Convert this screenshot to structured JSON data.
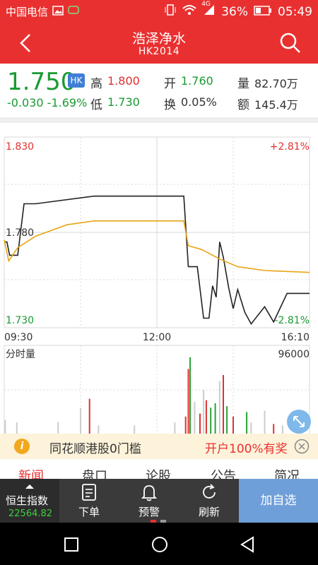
{
  "status_bar": {
    "carrier": "中国电信",
    "signal_label": "4G",
    "battery": "36%",
    "time": "05:49"
  },
  "header": {
    "title": "浩泽净水",
    "code": "HK2014"
  },
  "quote": {
    "price": "1.750",
    "market_badge": "HK",
    "change": "-0.030",
    "change_pct": "-1.69%",
    "high_label": "高",
    "high": "1.800",
    "low_label": "低",
    "low": "1.730",
    "open_label": "开",
    "open": "1.760",
    "turnover_label": "换",
    "turnover": "0.05%",
    "volume_label": "量",
    "volume": "82.70万",
    "amount_label": "额",
    "amount": "145.4万"
  },
  "chart_data": [
    {
      "type": "line",
      "series": [
        {
          "name": "",
          "color": "#222222",
          "x": [
            "09:30",
            "09:33",
            "09:36",
            "09:45",
            "09:52",
            "10:05",
            "11:10",
            "12:00",
            "13:50",
            "13:55",
            "14:05",
            "14:12",
            "14:18",
            "14:22",
            "14:26",
            "14:30",
            "14:34",
            "14:40",
            "14:45",
            "14:50",
            "14:58",
            "15:05",
            "15:20",
            "15:30",
            "15:45",
            "16:10"
          ],
          "values": [
            1.775,
            1.775,
            1.768,
            1.768,
            1.795,
            1.795,
            1.799,
            1.799,
            1.799,
            1.762,
            1.762,
            1.735,
            1.735,
            1.752,
            1.746,
            1.775,
            1.767,
            1.751,
            1.74,
            1.75,
            1.738,
            1.732,
            1.741,
            1.733,
            1.748,
            1.748
          ]
        },
        {
          "name": "",
          "color": "#e8a515",
          "x": [
            "09:30",
            "09:35",
            "09:45",
            "10:05",
            "10:40",
            "11:10",
            "12:00",
            "13:50",
            "13:55",
            "14:10",
            "14:30",
            "14:50",
            "15:20",
            "16:10"
          ],
          "values": [
            1.776,
            1.765,
            1.772,
            1.778,
            1.784,
            1.786,
            1.786,
            1.786,
            1.773,
            1.771,
            1.766,
            1.762,
            1.76,
            1.759
          ]
        }
      ],
      "y_labels": {
        "top": "1.830",
        "mid": "1.780",
        "bottom": "1.730"
      },
      "pct_labels": {
        "top": "+2.81%",
        "bottom": "-2.81%"
      },
      "x_labels": [
        "09:30",
        "12:00",
        "16:10"
      ],
      "ylim": [
        1.73,
        1.83
      ],
      "grid": true
    },
    {
      "type": "bar",
      "title": "分时量",
      "max_label": "96000",
      "bars": [
        {
          "x": "09:31",
          "v": 48,
          "c": "#cccccc"
        },
        {
          "x": "09:44",
          "v": 40,
          "c": "#cccccc"
        },
        {
          "x": "10:30",
          "v": 42,
          "c": "#cccccc"
        },
        {
          "x": "10:55",
          "v": 88,
          "c": "#cccccc"
        },
        {
          "x": "11:05",
          "v": 120,
          "c": "#e03030"
        },
        {
          "x": "11:15",
          "v": 30,
          "c": "#cccccc"
        },
        {
          "x": "11:55",
          "v": 30,
          "c": "#cccccc"
        },
        {
          "x": "13:40",
          "v": 40,
          "c": "#cccccc"
        },
        {
          "x": "13:52",
          "v": 60,
          "c": "#e03030"
        },
        {
          "x": "13:55",
          "v": 220,
          "c": "#e03030"
        },
        {
          "x": "13:57",
          "v": 260,
          "c": "#2aa233"
        },
        {
          "x": "14:02",
          "v": 110,
          "c": "#cccccc"
        },
        {
          "x": "14:08",
          "v": 70,
          "c": "#e03030"
        },
        {
          "x": "14:12",
          "v": 150,
          "c": "#cccccc"
        },
        {
          "x": "14:15",
          "v": 115,
          "c": "#e03030"
        },
        {
          "x": "14:20",
          "v": 90,
          "c": "#2aa233"
        },
        {
          "x": "14:25",
          "v": 105,
          "c": "#2aa233"
        },
        {
          "x": "14:30",
          "v": 180,
          "c": "#cccccc"
        },
        {
          "x": "14:34",
          "v": 200,
          "c": "#e03030"
        },
        {
          "x": "14:38",
          "v": 95,
          "c": "#2aa233"
        },
        {
          "x": "14:45",
          "v": 60,
          "c": "#e03030"
        },
        {
          "x": "15:00",
          "v": 75,
          "c": "#2aa233"
        },
        {
          "x": "15:05",
          "v": 40,
          "c": "#cccccc"
        },
        {
          "x": "15:20",
          "v": 80,
          "c": "#cccccc"
        },
        {
          "x": "15:30",
          "v": 35,
          "c": "#e03030"
        },
        {
          "x": "15:40",
          "v": 30,
          "c": "#cccccc"
        }
      ]
    }
  ],
  "banner": {
    "text": "同花顺港股0门槛",
    "cta": "开户100%有奖"
  },
  "tabs": [
    "新闻",
    "盘口",
    "论股",
    "公告",
    "简况"
  ],
  "bottom_bar": {
    "index_name": "恒生指数",
    "index_value": "22564.82",
    "order": "下单",
    "alert": "预警",
    "refresh": "刷新",
    "add_watch": "加自选"
  }
}
